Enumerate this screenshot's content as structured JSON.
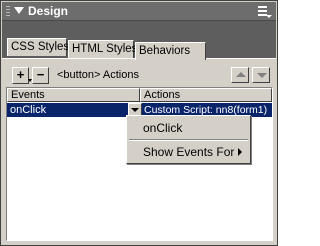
{
  "panel": {
    "title": "Design"
  },
  "tabs": [
    {
      "label": "CSS Styles"
    },
    {
      "label": "HTML Styles"
    },
    {
      "label": "Behaviors",
      "active": true
    }
  ],
  "toolbar": {
    "add_icon": "plus-icon",
    "remove_icon": "minus-icon",
    "tag_label": "<button> Actions",
    "add_symbol": "+",
    "remove_symbol": "−"
  },
  "table": {
    "columns": [
      "Events",
      "Actions"
    ],
    "rows": [
      {
        "event": "onClick",
        "action": "Custom Script: nn8(form1)",
        "selected": true
      }
    ]
  },
  "dropdown": {
    "items": [
      {
        "label": "onClick"
      },
      {
        "label": "Show Events For",
        "has_submenu": true
      }
    ]
  },
  "colors": {
    "selection": "#0a246a",
    "titlebar": "#6d6d6d",
    "face": "#d4d0c8"
  }
}
